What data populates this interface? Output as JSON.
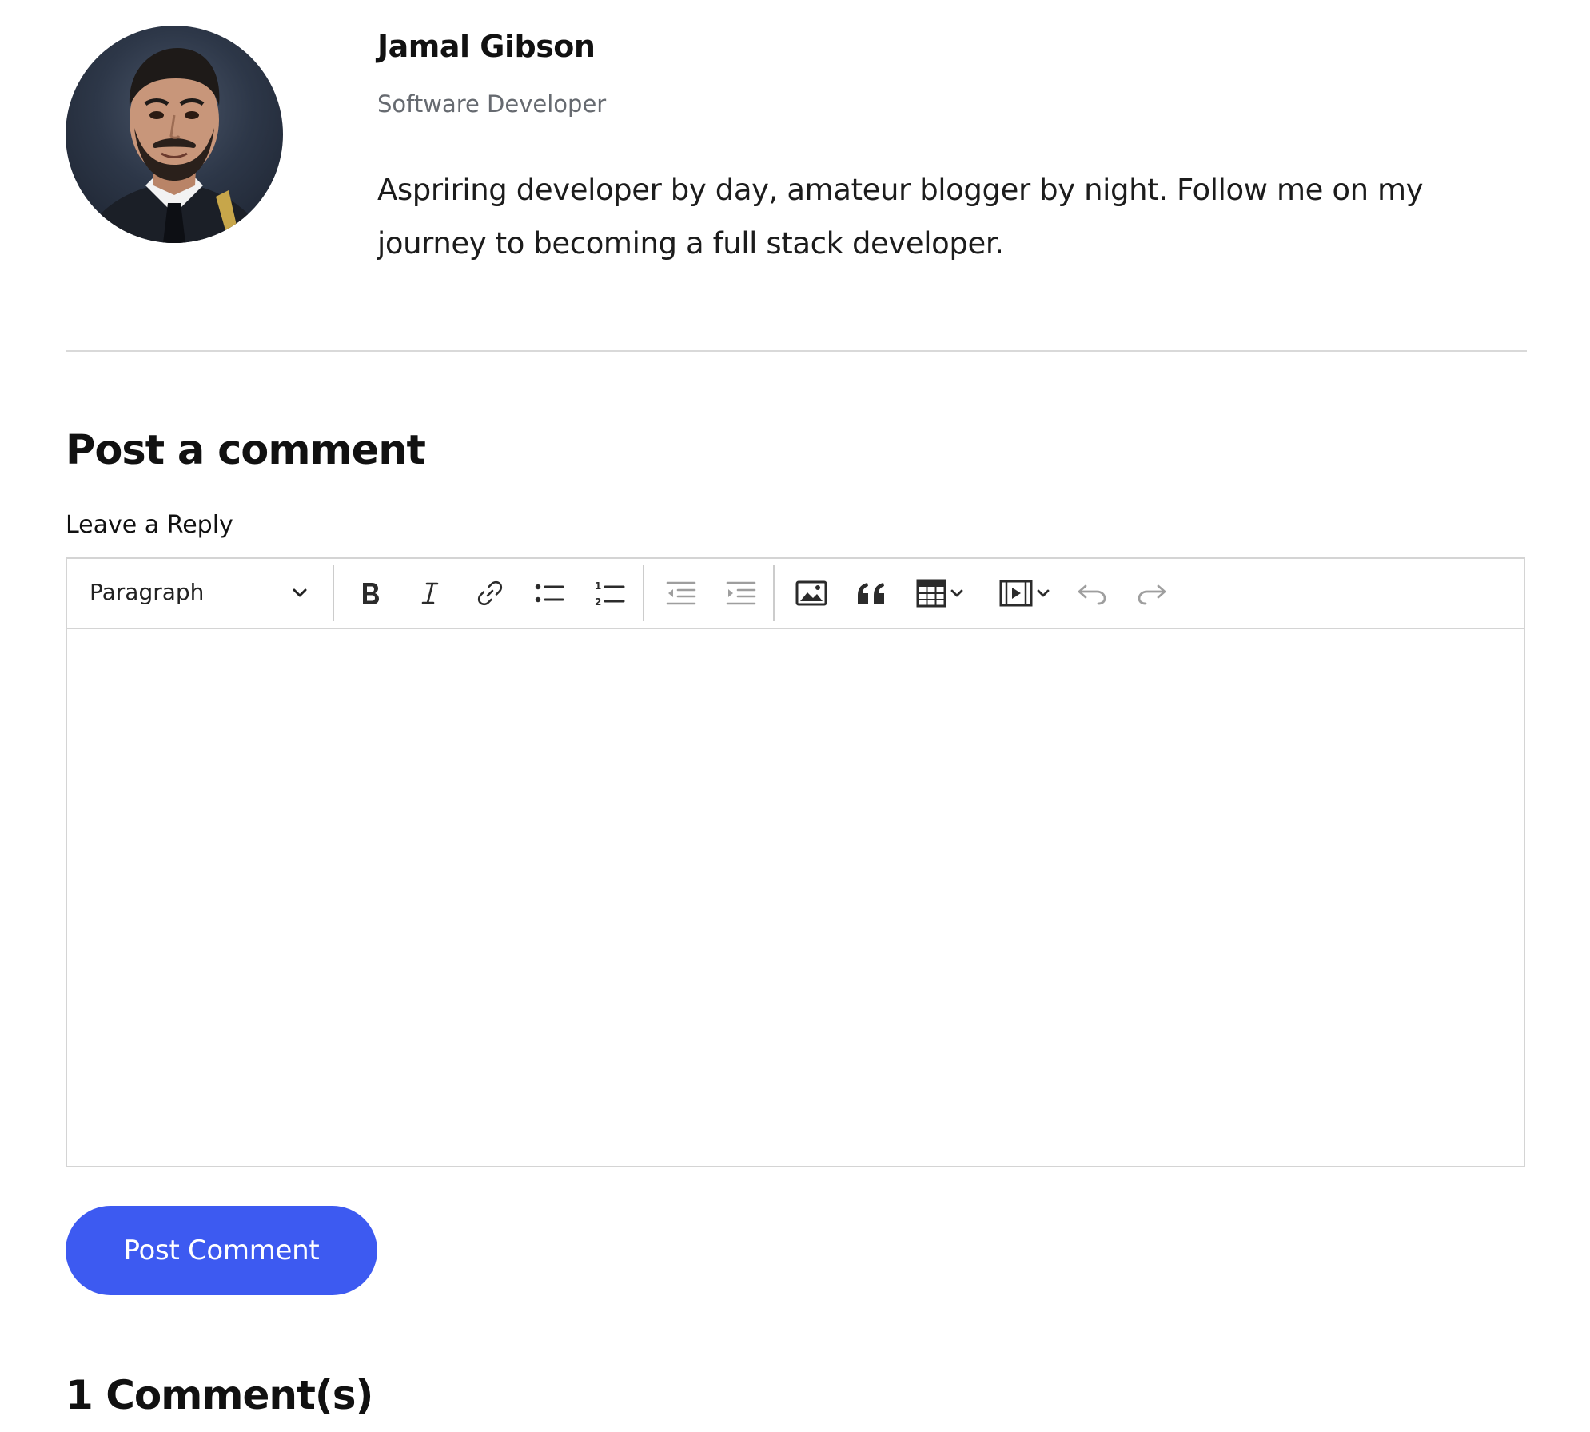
{
  "author": {
    "name": "Jamal Gibson",
    "role": "Software Developer",
    "bio": "Aspriring developer by day, amateur blogger by night. Follow me on my journey to becoming a full stack developer."
  },
  "comment_form": {
    "title": "Post a comment",
    "reply_label": "Leave a Reply",
    "editor": {
      "format_selected": "Paragraph",
      "content": "",
      "toolbar_icons": [
        "chevron-down-icon",
        "bold-icon",
        "italic-icon",
        "link-icon",
        "bulleted-list-icon",
        "numbered-list-icon",
        "outdent-icon",
        "indent-icon",
        "image-icon",
        "blockquote-icon",
        "table-icon",
        "media-embed-icon",
        "undo-icon",
        "redo-icon"
      ]
    },
    "submit_label": "Post Comment"
  },
  "comments": {
    "count_label": "1 Comment(s)"
  },
  "colors": {
    "accent": "#3d5af1",
    "text": "#111111",
    "muted": "#666a70",
    "border": "#d4d4d4"
  }
}
